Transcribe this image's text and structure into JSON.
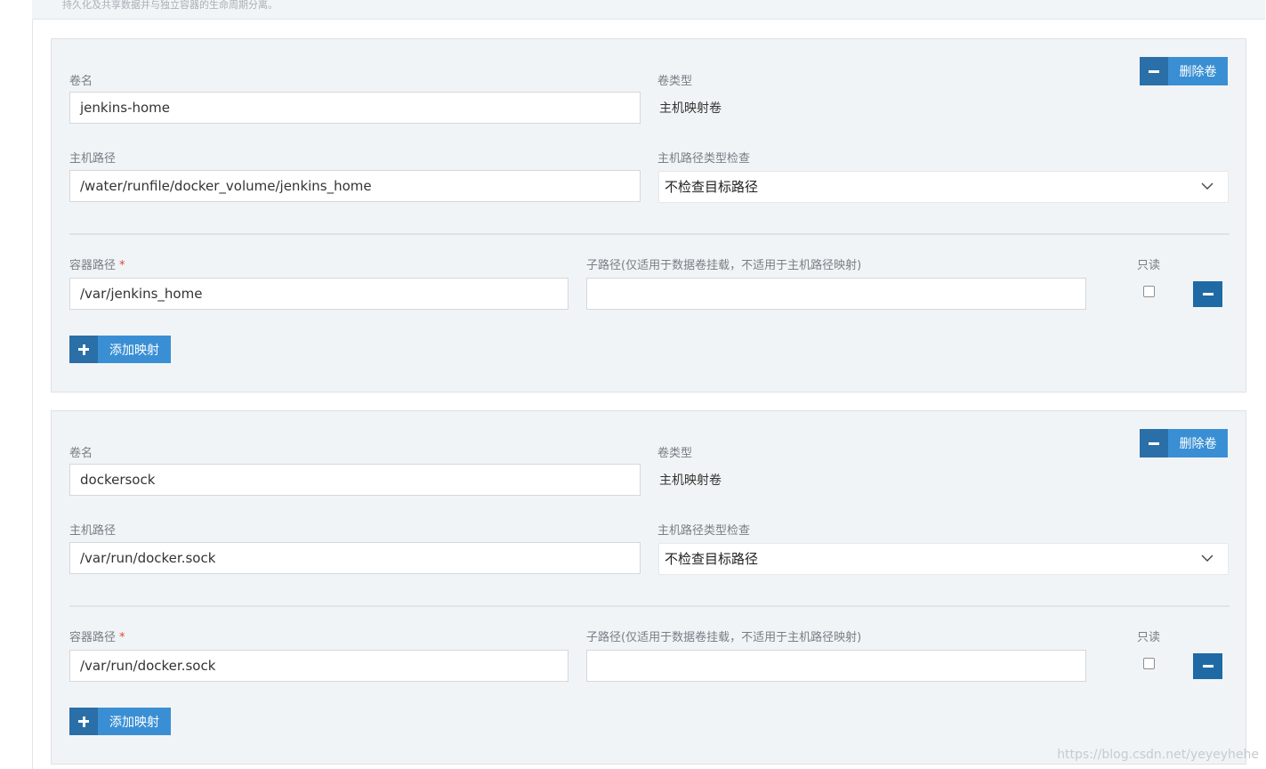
{
  "header_note": "持久化及共享数据并与独立容器的生命周期分离。",
  "volumes": [
    {
      "volume_name_label": "卷名",
      "volume_name": "jenkins-home",
      "volume_type_label": "卷类型",
      "volume_type": "主机映射卷",
      "remove_volume_label": "删除卷",
      "host_path_label": "主机路径",
      "host_path": "/water/runfile/docker_volume/jenkins_home",
      "host_path_check_label": "主机路径类型检查",
      "host_path_check_value": "不检查目标路径",
      "mount": {
        "container_path_label": "容器路径",
        "required_mark": "*",
        "container_path": "/var/jenkins_home",
        "subpath_label": "子路径(仅适用于数据卷挂载，不适用于主机路径映射)",
        "subpath": "",
        "readonly_label": "只读",
        "readonly": false
      },
      "add_mapping_label": "添加映射"
    },
    {
      "volume_name_label": "卷名",
      "volume_name": "dockersock",
      "volume_type_label": "卷类型",
      "volume_type": "主机映射卷",
      "remove_volume_label": "删除卷",
      "host_path_label": "主机路径",
      "host_path": "/var/run/docker.sock",
      "host_path_check_label": "主机路径类型检查",
      "host_path_check_value": "不检查目标路径",
      "mount": {
        "container_path_label": "容器路径",
        "required_mark": "*",
        "container_path": "/var/run/docker.sock",
        "subpath_label": "子路径(仅适用于数据卷挂载，不适用于主机路径映射)",
        "subpath": "",
        "readonly_label": "只读",
        "readonly": false
      },
      "add_mapping_label": "添加映射"
    }
  ],
  "watermark": "https://blog.csdn.net/yeyeyhehe",
  "colors": {
    "button_primary": "#3a8fd4",
    "button_icon_bg": "#2a6fa8",
    "minus_button": "#1f6aa5",
    "card_bg": "#f1f4f6",
    "required": "#e1453b"
  },
  "icons": {
    "remove_volume": "minus-icon",
    "add_mapping": "plus-icon",
    "remove_mapping": "minus-icon",
    "select": "chevron-down-icon"
  }
}
